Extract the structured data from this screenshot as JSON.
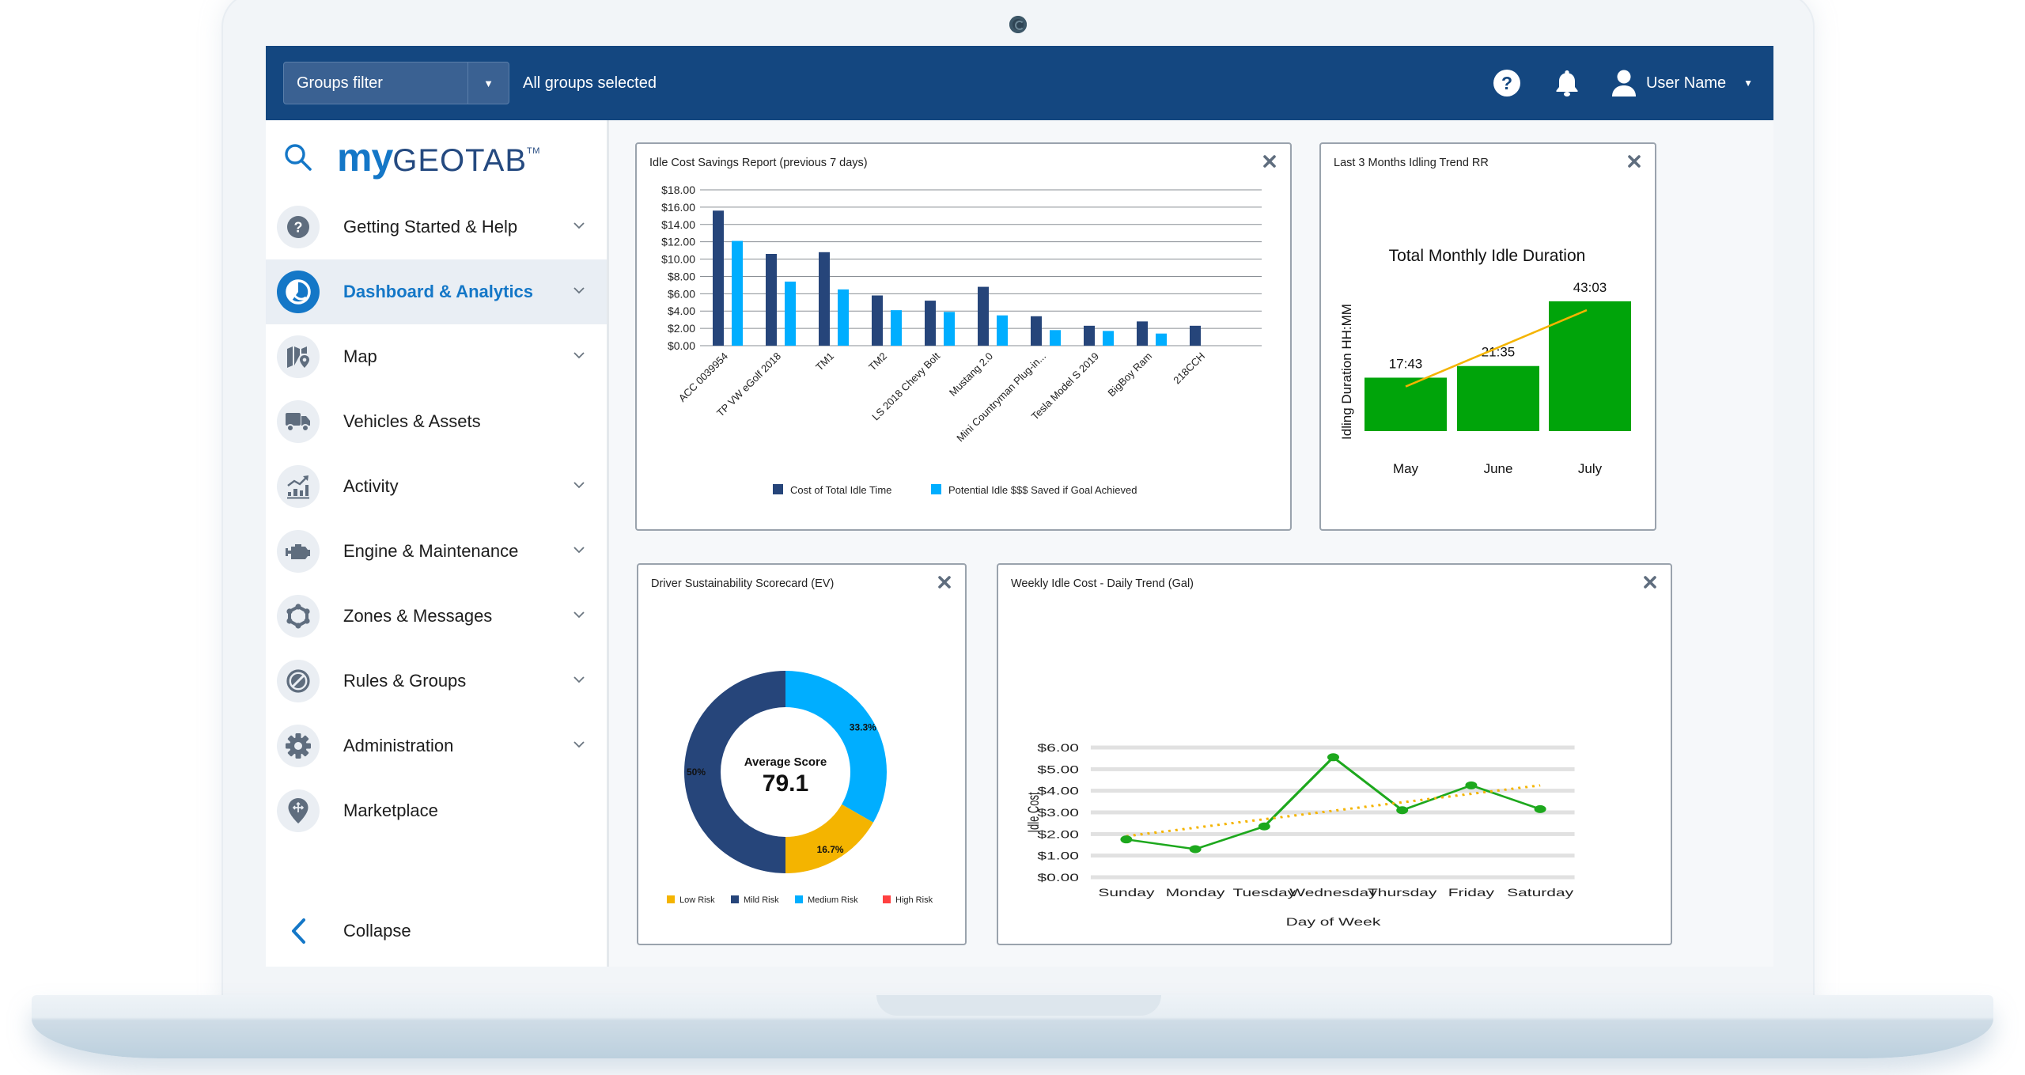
{
  "header": {
    "groups_filter_label": "Groups filter",
    "groups_status": "All groups selected",
    "help_icon": "question-circle-icon",
    "notifications_icon": "bell-icon",
    "user_icon": "user-icon",
    "user_name": "User Name"
  },
  "brand": {
    "logo_my": "my",
    "logo_geotab": "GEOTAB",
    "logo_tm": "TM"
  },
  "sidebar": {
    "items": [
      {
        "label": "Getting Started & Help",
        "icon": "help-icon",
        "expandable": true,
        "active": false
      },
      {
        "label": "Dashboard & Analytics",
        "icon": "pie-chart-icon",
        "expandable": true,
        "active": true
      },
      {
        "label": "Map",
        "icon": "map-icon",
        "expandable": true,
        "active": false
      },
      {
        "label": "Vehicles & Assets",
        "icon": "truck-icon",
        "expandable": false,
        "active": false
      },
      {
        "label": "Activity",
        "icon": "activity-chart-icon",
        "expandable": true,
        "active": false
      },
      {
        "label": "Engine & Maintenance",
        "icon": "engine-icon",
        "expandable": true,
        "active": false
      },
      {
        "label": "Zones & Messages",
        "icon": "zones-icon",
        "expandable": true,
        "active": false
      },
      {
        "label": "Rules & Groups",
        "icon": "rules-icon",
        "expandable": true,
        "active": false
      },
      {
        "label": "Administration",
        "icon": "gear-icon",
        "expandable": true,
        "active": false
      },
      {
        "label": "Marketplace",
        "icon": "marketplace-pin-icon",
        "expandable": false,
        "active": false
      }
    ],
    "collapse_label": "Collapse"
  },
  "colors": {
    "header_blue": "#144780",
    "accent_blue": "#1477c7",
    "dark_navy": "#26457a",
    "light_blue": "#00aeff",
    "green": "#00a40a",
    "gold": "#f4b400",
    "red": "#ff4040"
  },
  "chart_data": [
    {
      "id": "idle-cost-savings",
      "panel_title": "Idle Cost Savings Report (previous 7 days)",
      "type": "bar",
      "title": "",
      "xlabel": "",
      "ylabel": "",
      "ylim": [
        0,
        18
      ],
      "yticks": [
        "$0.00",
        "$2.00",
        "$4.00",
        "$6.00",
        "$8.00",
        "$10.00",
        "$12.00",
        "$14.00",
        "$16.00",
        "$18.00"
      ],
      "categories": [
        "ACC 0039954",
        "TP VW eGolf 2018",
        "TM1",
        "TM2",
        "LS 2018 Chevy Bolt",
        "Mustang 2.0",
        "Mini Countryman Plug-in...",
        "Tesla Model S 2019",
        "BigBoy Ram",
        "218CCH"
      ],
      "series": [
        {
          "name": "Cost of Total Idle Time",
          "color": "#26457a",
          "values": [
            15.6,
            10.6,
            10.8,
            5.8,
            5.2,
            6.8,
            3.4,
            2.3,
            2.8,
            2.3
          ]
        },
        {
          "name": "Potential Idle $$$ Saved if Goal Achieved",
          "color": "#00aeff",
          "values": [
            12.1,
            7.4,
            6.5,
            4.1,
            3.9,
            3.5,
            1.8,
            1.7,
            1.4,
            0
          ]
        }
      ],
      "grid": true,
      "legend": "bottom"
    },
    {
      "id": "monthly-idle-duration",
      "panel_title": "Last 3 Months Idling Trend RR",
      "type": "bar",
      "title": "Total Monthly Idle Duration",
      "xlabel": "",
      "ylabel": "Idling Duration HH:MM",
      "categories": [
        "May",
        "June",
        "July"
      ],
      "values": [
        17.72,
        21.58,
        43.05
      ],
      "value_labels": [
        "17:43",
        "21:35",
        "43:03"
      ],
      "trendline": true,
      "trend_color": "#f4b400",
      "bar_color": "#00a40a",
      "ylim": [
        0,
        48
      ],
      "grid": false
    },
    {
      "id": "driver-scorecard",
      "panel_title": "Driver Sustainability Scorecard (EV)",
      "type": "pie",
      "donut": true,
      "center_label": "Average Score",
      "center_value": "79.1",
      "slices": [
        {
          "name": "Medium Risk",
          "value": 33.3,
          "label": "33.3%",
          "color": "#00aeff"
        },
        {
          "name": "Low Risk",
          "value": 16.7,
          "label": "16.7%",
          "color": "#f4b400"
        },
        {
          "name": "Mild Risk",
          "value": 50,
          "label": "50%",
          "color": "#26457a"
        }
      ],
      "legend_entries": [
        {
          "name": "Low Risk",
          "color": "#f4b400"
        },
        {
          "name": "Mild Risk",
          "color": "#26457a"
        },
        {
          "name": "Medium Risk",
          "color": "#00aeff"
        },
        {
          "name": "High Risk",
          "color": "#ff4040"
        }
      ],
      "legend": "bottom"
    },
    {
      "id": "weekly-idle-cost",
      "panel_title": "Weekly Idle Cost - Daily Trend (Gal)",
      "type": "line",
      "title": "",
      "xlabel": "Day of Week",
      "ylabel": "Idle Cost",
      "ylim": [
        0,
        6
      ],
      "yticks": [
        "$0.00",
        "$1.00",
        "$2.00",
        "$3.00",
        "$4.00",
        "$5.00",
        "$6.00"
      ],
      "categories": [
        "Sunday",
        "Monday",
        "Tuesday",
        "Wednesday",
        "Thursday",
        "Friday",
        "Saturday"
      ],
      "series": [
        {
          "name": "Idle Cost",
          "color": "#1da81d",
          "values": [
            1.75,
            1.3,
            2.35,
            5.55,
            3.1,
            4.25,
            3.15
          ]
        }
      ],
      "trendline": {
        "start": 1.9,
        "end": 4.25,
        "color": "#f4b400",
        "style": "dotted"
      },
      "grid": true
    }
  ]
}
